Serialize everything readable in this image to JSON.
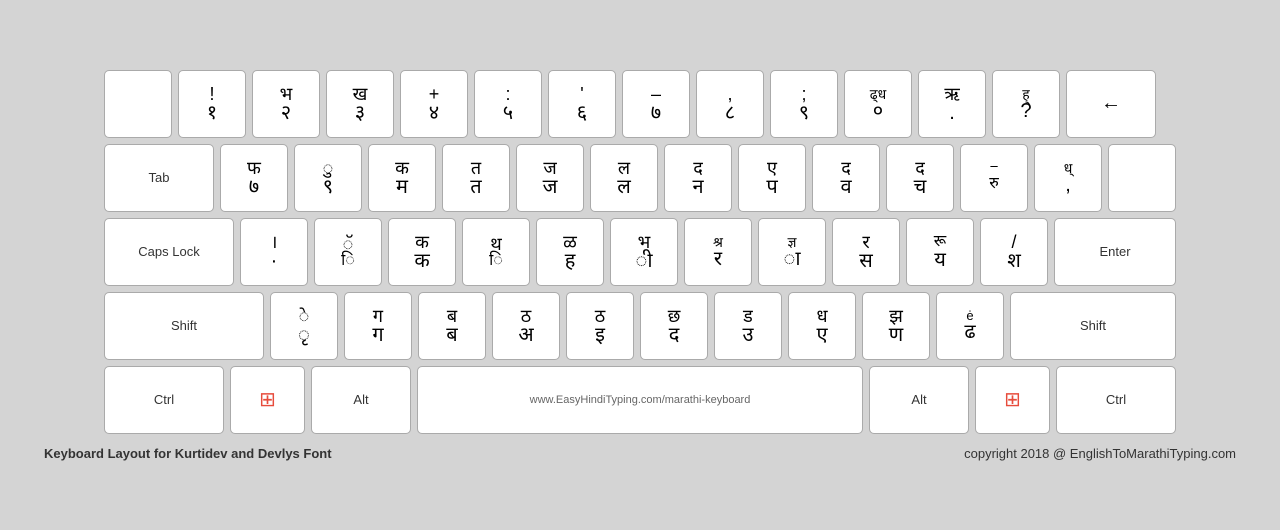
{
  "keyboard": {
    "title": "Keyboard Layout for Kurtidev and Devlys Font",
    "copyright": "copyright 2018 @ EnglishToMarathiTyping.com",
    "url": "www.EasyHindiTyping.com/marathi-keyboard",
    "rows": [
      {
        "keys": [
          {
            "id": "backtick",
            "top": "",
            "bottom": "~",
            "label": ""
          },
          {
            "id": "1",
            "top": "!",
            "bottom": "१"
          },
          {
            "id": "2",
            "top": "भ",
            "bottom": "२"
          },
          {
            "id": "3",
            "top": "ख",
            "bottom": "३"
          },
          {
            "id": "4",
            "top": "+",
            "bottom": "४"
          },
          {
            "id": "5",
            "top": ":",
            "bottom": "५"
          },
          {
            "id": "6",
            "top": "'",
            "bottom": "६"
          },
          {
            "id": "7",
            "top": "–",
            "bottom": "७"
          },
          {
            "id": "8",
            "top": ",",
            "bottom": "८"
          },
          {
            "id": "9",
            "top": ";",
            "bottom": "९"
          },
          {
            "id": "0",
            "top": "ढ्ध",
            "bottom": "०"
          },
          {
            "id": "minus",
            "top": "ऋ",
            "bottom": "."
          },
          {
            "id": "equals",
            "top": "ह्",
            "bottom": "?"
          },
          {
            "id": "backspace",
            "label": "←",
            "wide": true
          }
        ]
      },
      {
        "keys": [
          {
            "id": "tab",
            "label": "Tab",
            "wide": true
          },
          {
            "id": "q",
            "top": "फ",
            "bottom": "७"
          },
          {
            "id": "w",
            "top": "ु",
            "bottom": "९"
          },
          {
            "id": "e",
            "top": "क",
            "bottom": "म"
          },
          {
            "id": "r",
            "top": "त",
            "bottom": "त"
          },
          {
            "id": "t",
            "top": "ज",
            "bottom": "ज"
          },
          {
            "id": "y",
            "top": "ल",
            "bottom": "ल"
          },
          {
            "id": "u",
            "top": "द",
            "bottom": "न"
          },
          {
            "id": "i",
            "top": "ए",
            "bottom": "प"
          },
          {
            "id": "o",
            "top": "द",
            "bottom": "व"
          },
          {
            "id": "p",
            "top": "द",
            "bottom": "च"
          },
          {
            "id": "bracketleft",
            "top": "ꣻ",
            "bottom": "रु"
          },
          {
            "id": "bracketright",
            "top": "ध्",
            "bottom": ","
          },
          {
            "id": "backslash",
            "label": ""
          }
        ]
      },
      {
        "keys": [
          {
            "id": "capslock",
            "label": "Caps Lock",
            "wide": true
          },
          {
            "id": "a",
            "top": "।",
            "bottom": "·"
          },
          {
            "id": "s",
            "top": "ॅ",
            "bottom": "ि"
          },
          {
            "id": "d",
            "top": "क",
            "bottom": "क"
          },
          {
            "id": "f",
            "top": "थ",
            "bottom": "ि"
          },
          {
            "id": "g",
            "top": "ळ",
            "bottom": "ह"
          },
          {
            "id": "h",
            "top": "भ",
            "bottom": "ी"
          },
          {
            "id": "j",
            "top": "श्र",
            "bottom": "र"
          },
          {
            "id": "k",
            "top": "ज्ञ",
            "bottom": "ा"
          },
          {
            "id": "l",
            "top": "र",
            "bottom": "स"
          },
          {
            "id": "semicolon",
            "top": "रू",
            "bottom": "य"
          },
          {
            "id": "quote",
            "top": "/",
            "bottom": "श"
          },
          {
            "id": "enter",
            "label": "Enter",
            "wide": true
          }
        ]
      },
      {
        "keys": [
          {
            "id": "shift-left",
            "label": "Shift",
            "wide": true
          },
          {
            "id": "z",
            "top": "े",
            "bottom": "ृ"
          },
          {
            "id": "x",
            "top": "ग",
            "bottom": "ग"
          },
          {
            "id": "c",
            "top": "ब",
            "bottom": "ब"
          },
          {
            "id": "v",
            "top": "ठ",
            "bottom": "अ"
          },
          {
            "id": "b",
            "top": "ठ",
            "bottom": "इ"
          },
          {
            "id": "n",
            "top": "छ",
            "bottom": "द"
          },
          {
            "id": "m",
            "top": "ड",
            "bottom": "उ"
          },
          {
            "id": "comma",
            "top": "ध",
            "bottom": "ए"
          },
          {
            "id": "period",
            "top": "झ",
            "bottom": "ण"
          },
          {
            "id": "slash",
            "top": "ė",
            "bottom": "ढ"
          },
          {
            "id": "shift-right",
            "label": "Shift",
            "wide": true
          }
        ]
      },
      {
        "keys": [
          {
            "id": "ctrl-left",
            "label": "Ctrl",
            "wide": true
          },
          {
            "id": "win-left",
            "label": "win",
            "wide": false
          },
          {
            "id": "alt-left",
            "label": "Alt",
            "wide": true
          },
          {
            "id": "spacebar",
            "label": "www.EasyHindiTyping.com/marathi-keyboard",
            "wide": true
          },
          {
            "id": "alt-right",
            "label": "Alt",
            "wide": true
          },
          {
            "id": "win-right",
            "label": "win",
            "wide": false
          },
          {
            "id": "ctrl-right",
            "label": "Ctrl",
            "wide": true
          }
        ]
      }
    ]
  }
}
